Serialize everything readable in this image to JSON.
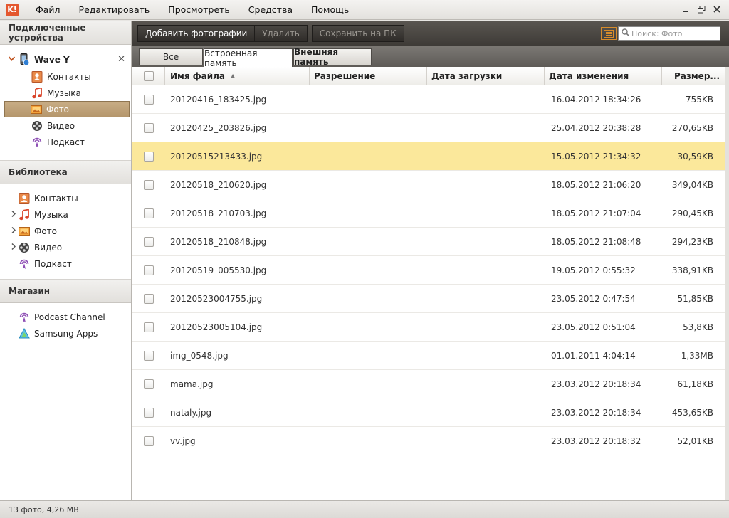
{
  "app": {
    "logo": "K!"
  },
  "menu": [
    "Файл",
    "Редактировать",
    "Просмотреть",
    "Средства",
    "Помощь"
  ],
  "window_controls": [
    "minimize-icon",
    "restore-icon",
    "close-icon"
  ],
  "sidebar": {
    "connected_header": "Подключенные устройства",
    "device": {
      "name": "Wave Y",
      "icon": "phone-sync-icon",
      "close": "✕"
    },
    "device_items": [
      {
        "label": "Контакты",
        "icon": "contacts-icon"
      },
      {
        "label": "Музыка",
        "icon": "music-icon"
      },
      {
        "label": "Фото",
        "icon": "photo-icon",
        "selected": true
      },
      {
        "label": "Видео",
        "icon": "video-icon"
      },
      {
        "label": "Подкаст",
        "icon": "podcast-icon"
      }
    ],
    "library_header": "Библиотека",
    "library_items": [
      {
        "label": "Контакты",
        "icon": "contacts-icon",
        "expandable": false
      },
      {
        "label": "Музыка",
        "icon": "music-icon",
        "expandable": true
      },
      {
        "label": "Фото",
        "icon": "photo-icon",
        "expandable": true
      },
      {
        "label": "Видео",
        "icon": "video-icon",
        "expandable": true
      },
      {
        "label": "Подкаст",
        "icon": "podcast-icon",
        "expandable": false
      }
    ],
    "store_header": "Магазин",
    "store_items": [
      {
        "label": "Podcast Channel",
        "icon": "podcast-channel-icon"
      },
      {
        "label": "Samsung Apps",
        "icon": "samsung-apps-icon"
      }
    ]
  },
  "toolbar": {
    "add_photos": "Добавить фотографии",
    "delete": "Удалить",
    "save_to_pc": "Сохранить на ПК",
    "search_placeholder": "Поиск: Фото"
  },
  "tabs": [
    "Все",
    "Встроенная память",
    "Внешняя память"
  ],
  "active_tab": "Встроенная память",
  "columns": {
    "name": "Имя файла",
    "resolution": "Разрешение",
    "upload_date": "Дата загрузки",
    "modified": "Дата изменения",
    "size": "Размер..."
  },
  "rows": [
    {
      "name": "20120416_183425.jpg",
      "resolution": "",
      "upload_date": "",
      "modified": "16.04.2012 18:34:26",
      "size": "755KB"
    },
    {
      "name": "20120425_203826.jpg",
      "resolution": "",
      "upload_date": "",
      "modified": "25.04.2012 20:38:28",
      "size": "270,65KB"
    },
    {
      "name": "20120515213433.jpg",
      "resolution": "",
      "upload_date": "",
      "modified": "15.05.2012 21:34:32",
      "size": "30,59KB",
      "highlight": true
    },
    {
      "name": "20120518_210620.jpg",
      "resolution": "",
      "upload_date": "",
      "modified": "18.05.2012 21:06:20",
      "size": "349,04KB"
    },
    {
      "name": "20120518_210703.jpg",
      "resolution": "",
      "upload_date": "",
      "modified": "18.05.2012 21:07:04",
      "size": "290,45KB"
    },
    {
      "name": "20120518_210848.jpg",
      "resolution": "",
      "upload_date": "",
      "modified": "18.05.2012 21:08:48",
      "size": "294,23KB"
    },
    {
      "name": "20120519_005530.jpg",
      "resolution": "",
      "upload_date": "",
      "modified": "19.05.2012 0:55:32",
      "size": "338,91KB"
    },
    {
      "name": "20120523004755.jpg",
      "resolution": "",
      "upload_date": "",
      "modified": "23.05.2012 0:47:54",
      "size": "51,85KB"
    },
    {
      "name": "20120523005104.jpg",
      "resolution": "",
      "upload_date": "",
      "modified": "23.05.2012 0:51:04",
      "size": "53,8KB"
    },
    {
      "name": "img_0548.jpg",
      "resolution": "",
      "upload_date": "",
      "modified": "01.01.2011 4:04:14",
      "size": "1,33MB"
    },
    {
      "name": "mama.jpg",
      "resolution": "",
      "upload_date": "",
      "modified": "23.03.2012 20:18:34",
      "size": "61,18KB"
    },
    {
      "name": "nataly.jpg",
      "resolution": "",
      "upload_date": "",
      "modified": "23.03.2012 20:18:34",
      "size": "453,65KB"
    },
    {
      "name": "vv.jpg",
      "resolution": "",
      "upload_date": "",
      "modified": "23.03.2012 20:18:32",
      "size": "52,01KB"
    }
  ],
  "status": "13 фото, 4,26 MB",
  "colors": {
    "highlight": "#fbe89b",
    "selected_nav": "#b5966c",
    "toolbar": "#3d3a36",
    "accent": "#d78c2b"
  }
}
